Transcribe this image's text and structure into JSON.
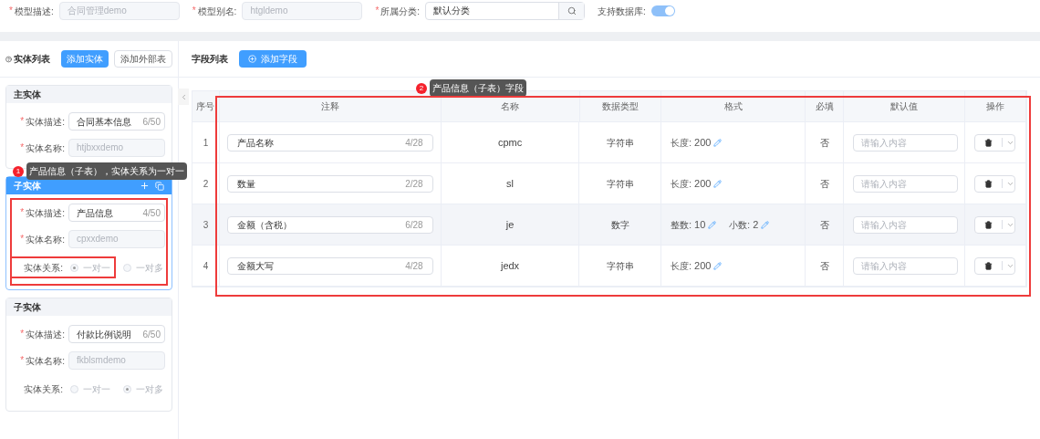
{
  "form": {
    "fields": [
      {
        "label": "模型描述:",
        "marker": "*",
        "value": "合同管理demo",
        "kind": "disabled"
      },
      {
        "label": "模型别名:",
        "marker": "*",
        "value": "htgldemo",
        "kind": "disabled"
      },
      {
        "label": "所属分类:",
        "marker": "*",
        "value": "默认分类",
        "kind": "search"
      }
    ],
    "switch": {
      "label": "支持数据库:",
      "on": true
    }
  },
  "entity_panel": {
    "title": "实体列表",
    "buttons": [
      {
        "label": "添加实体",
        "kind": "primary"
      },
      {
        "label": "添加外部表",
        "kind": "plain"
      }
    ],
    "entities": [
      {
        "header": "主实体",
        "selected": false,
        "fields": [
          {
            "label": "实体描述:",
            "marker": "*",
            "value": "合同基本信息",
            "counter": "6/50",
            "kind": "text"
          },
          {
            "label": "实体名称:",
            "marker": "*",
            "value": "htjbxxdemo",
            "kind": "disabled"
          }
        ]
      },
      {
        "header": "子实体",
        "selected": true,
        "fields": [
          {
            "label": "实体描述:",
            "marker": "*",
            "value": "产品信息",
            "counter": "4/50",
            "kind": "text"
          },
          {
            "label": "实体名称:",
            "marker": "*",
            "value": "cpxxdemo",
            "kind": "disabled"
          }
        ],
        "relation": {
          "label": "实体关系:",
          "options": [
            {
              "label": "一对一",
              "selected": true
            },
            {
              "label": "一对多",
              "selected": false
            }
          ]
        }
      },
      {
        "header": "子实体",
        "selected": false,
        "fields": [
          {
            "label": "实体描述:",
            "marker": "*",
            "value": "付款比例说明",
            "counter": "6/50",
            "kind": "text"
          },
          {
            "label": "实体名称:",
            "marker": "*",
            "value": "fkblsmdemo",
            "kind": "disabled"
          }
        ],
        "relation": {
          "label": "实体关系:",
          "options": [
            {
              "label": "一对一",
              "selected": false
            },
            {
              "label": "一对多",
              "selected": true
            }
          ]
        }
      }
    ]
  },
  "field_panel": {
    "title": "字段列表",
    "add_button": "添加字段",
    "columns": [
      "序号",
      "注释",
      "名称",
      "数据类型",
      "格式",
      "必填",
      "默认值",
      "操作"
    ],
    "rows": [
      {
        "index": "1",
        "comment": "产品名称",
        "counter": "4/28",
        "name": "cpmc",
        "type": "字符串",
        "format": [
          {
            "label": "长度:",
            "value": "200"
          }
        ],
        "required": "否",
        "placeholder": "请输入内容",
        "hovered": false
      },
      {
        "index": "2",
        "comment": "数量",
        "counter": "2/28",
        "name": "sl",
        "type": "字符串",
        "format": [
          {
            "label": "长度:",
            "value": "200"
          }
        ],
        "required": "否",
        "placeholder": "请输入内容",
        "hovered": false
      },
      {
        "index": "3",
        "comment": "金额（含税）",
        "counter": "6/28",
        "name": "je",
        "type": "数字",
        "format": [
          {
            "label": "整数:",
            "value": "10"
          },
          {
            "label": "小数:",
            "value": "2"
          }
        ],
        "required": "否",
        "placeholder": "请输入内容",
        "hovered": true
      },
      {
        "index": "4",
        "comment": "金额大写",
        "counter": "4/28",
        "name": "jedx",
        "type": "字符串",
        "format": [
          {
            "label": "长度:",
            "value": "200"
          }
        ],
        "required": "否",
        "placeholder": "请输入内容",
        "hovered": false
      }
    ]
  },
  "annotations": [
    {
      "number": "1",
      "text": "产品信息（子表），实体关系为一对一"
    },
    {
      "number": "2",
      "text": "产品信息（子表）字段"
    }
  ]
}
